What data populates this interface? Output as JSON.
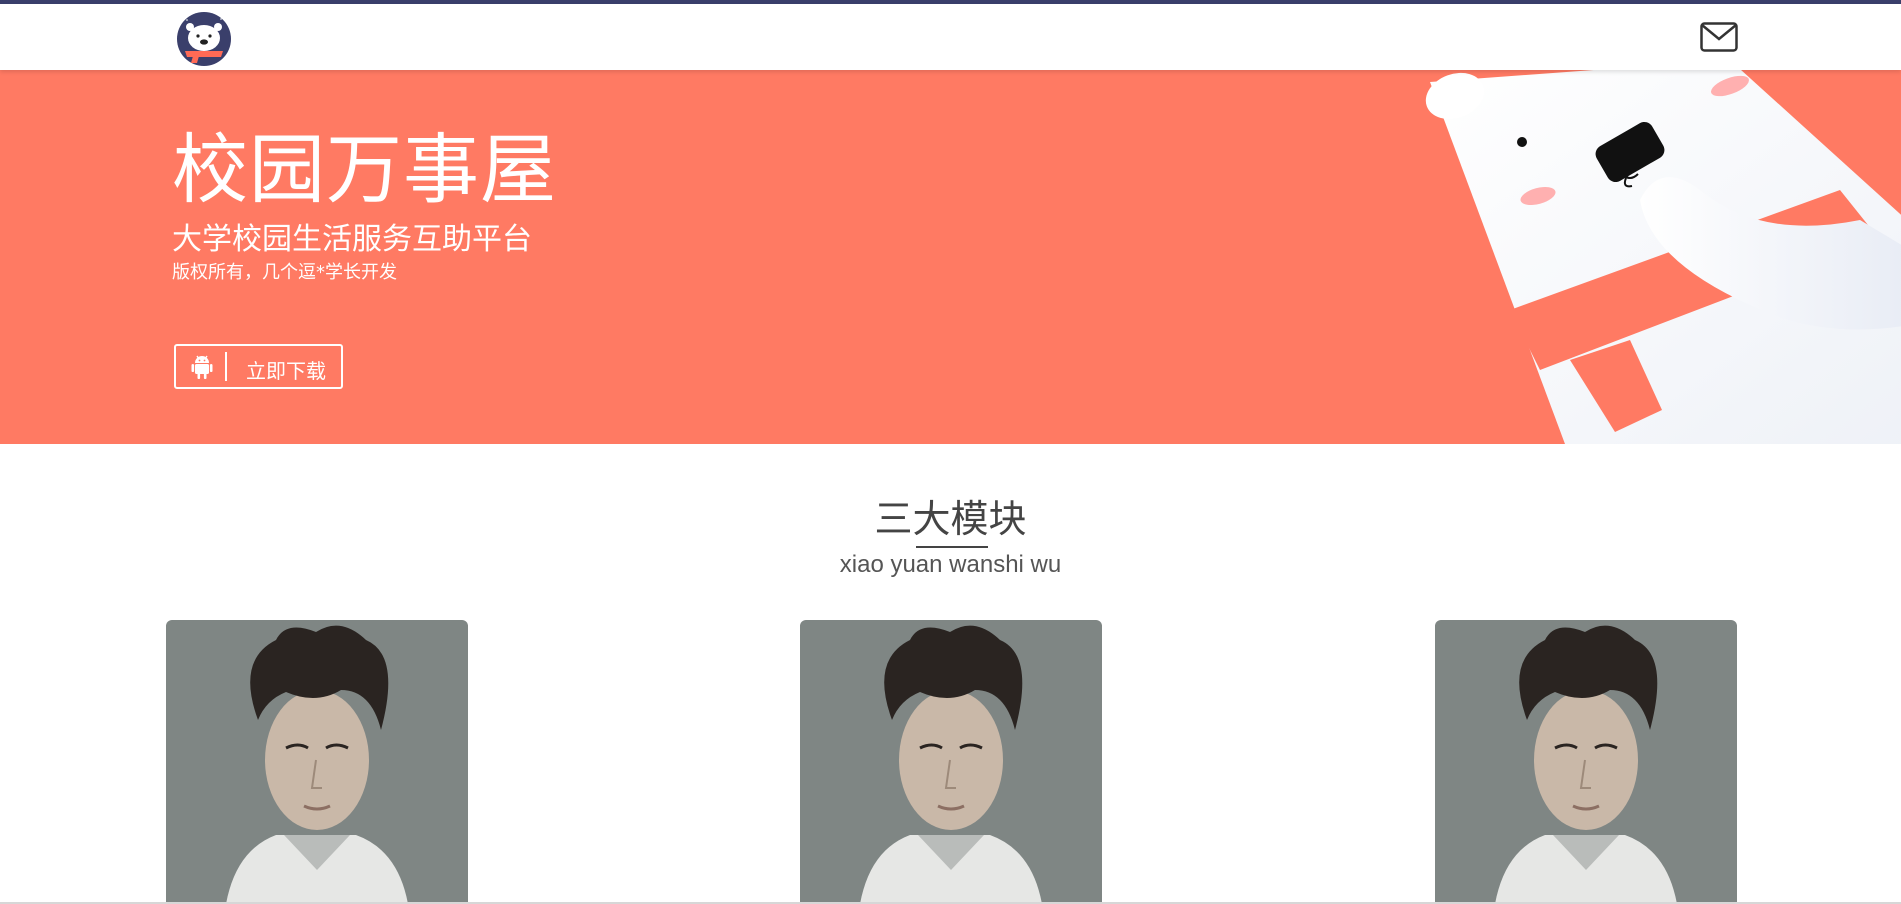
{
  "navbar": {
    "logo_icon": "polar-bear-logo-icon",
    "mail_icon": "mail-icon"
  },
  "hero": {
    "title": "校园万事屋",
    "subtitle": "大学校园生活服务互助平台",
    "copyright": "版权所有，几个逗*学长开发",
    "download_label": "立即下载",
    "download_icon": "android-icon",
    "illustration": "polar-bear-illustration",
    "background_color": "#ff7a63",
    "accent_color": "#3a3f6b"
  },
  "modules": {
    "title": "三大模块",
    "subtitle": "xiao yuan wanshi wu",
    "cards": [
      {
        "image": "portrait-photo"
      },
      {
        "image": "portrait-photo"
      },
      {
        "image": "portrait-photo"
      }
    ]
  }
}
